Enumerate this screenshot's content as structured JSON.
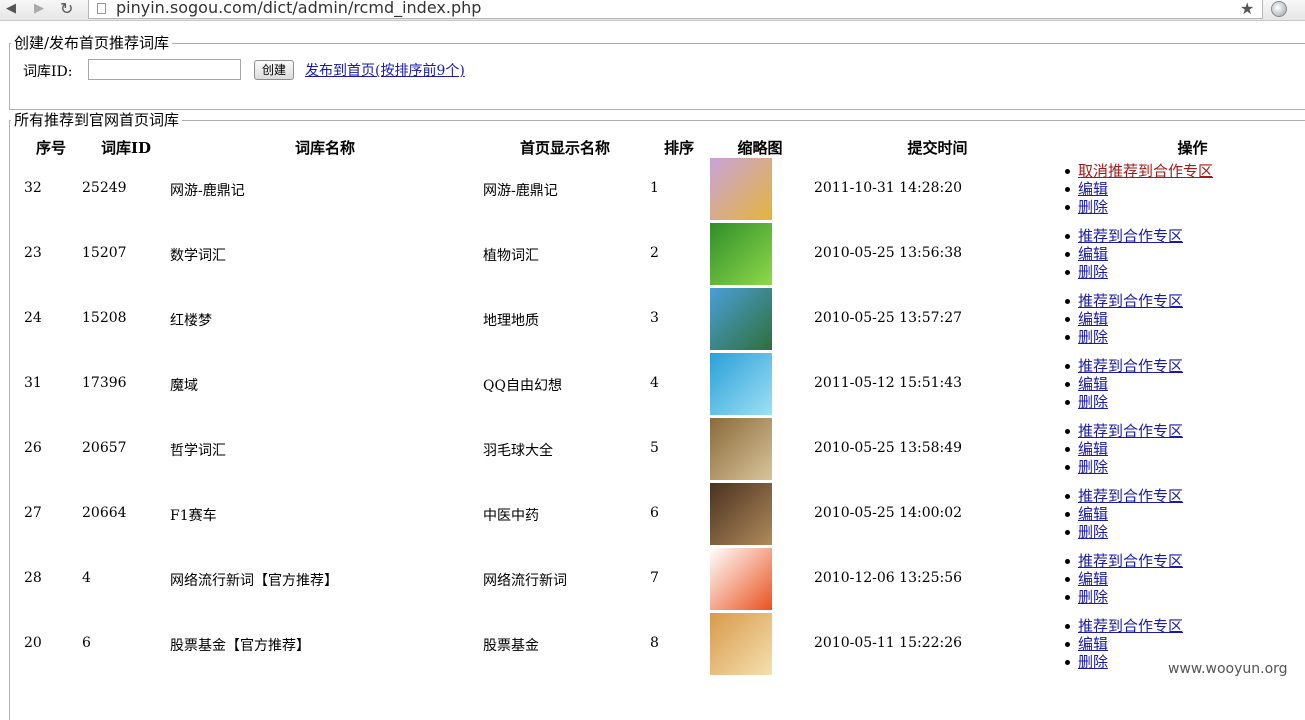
{
  "browser": {
    "url": "pinyin.sogou.com/dict/admin/rcmd_index.php",
    "icons": [
      "back-icon",
      "forward-icon",
      "reload-icon",
      "page-icon",
      "star-icon",
      "globe-icon"
    ]
  },
  "create_section": {
    "legend": "创建/发布首页推荐词库",
    "id_label": "词库ID:",
    "id_value": "",
    "create_button": "创建",
    "publish_link": "发布到首页(按排序前9个)"
  },
  "list_section": {
    "legend": "所有推荐到官网首页词库",
    "headers": [
      "序号",
      "词库ID",
      "词库名称",
      "首页显示名称",
      "排序",
      "缩略图",
      "提交时间",
      "操作"
    ],
    "rows": [
      {
        "seq": "32",
        "id": "25249",
        "name": "网游-鹿鼎记",
        "display": "网游-鹿鼎记",
        "order": "1",
        "thumb": "luding-game-thumb",
        "time": "2011-10-31 14:28:20",
        "ops": [
          "取消推荐到合作专区",
          "编辑",
          "删除"
        ],
        "thumb_colors": [
          "#c9a3d9",
          "#e4b43a"
        ]
      },
      {
        "seq": "23",
        "id": "15207",
        "name": "数学词汇",
        "display": "植物词汇",
        "order": "2",
        "thumb": "clover-thumb",
        "time": "2010-05-25 13:56:38",
        "ops": [
          "推荐到合作专区",
          "编辑",
          "删除"
        ],
        "thumb_colors": [
          "#2f8f2a",
          "#8fd84a"
        ]
      },
      {
        "seq": "24",
        "id": "15208",
        "name": "红楼梦",
        "display": "地理地质",
        "order": "3",
        "thumb": "coast-thumb",
        "time": "2010-05-25 13:57:27",
        "ops": [
          "推荐到合作专区",
          "编辑",
          "删除"
        ],
        "thumb_colors": [
          "#4a9fd8",
          "#2f6f3a"
        ]
      },
      {
        "seq": "31",
        "id": "17396",
        "name": "魔域",
        "display": "QQ自由幻想",
        "order": "4",
        "thumb": "qq-fantasy-thumb",
        "time": "2011-05-12 15:51:43",
        "ops": [
          "推荐到合作专区",
          "编辑",
          "删除"
        ],
        "thumb_colors": [
          "#2aa0d8",
          "#9fe0f5"
        ]
      },
      {
        "seq": "26",
        "id": "20657",
        "name": "哲学词汇",
        "display": "羽毛球大全",
        "order": "5",
        "thumb": "badminton-thumb",
        "time": "2010-05-25 13:58:49",
        "ops": [
          "推荐到合作专区",
          "编辑",
          "删除"
        ],
        "thumb_colors": [
          "#8a6a3a",
          "#d8c49a"
        ]
      },
      {
        "seq": "27",
        "id": "20664",
        "name": "F1赛车",
        "display": "中医中药",
        "order": "6",
        "thumb": "herbs-thumb",
        "time": "2010-05-25 14:00:02",
        "ops": [
          "推荐到合作专区",
          "编辑",
          "删除"
        ],
        "thumb_colors": [
          "#4a3220",
          "#b08a5a"
        ]
      },
      {
        "seq": "28",
        "id": "4",
        "name": "网络流行新词【官方推荐】",
        "display": "网络流行新词",
        "order": "7",
        "thumb": "sogou-logo-thumb",
        "time": "2010-12-06 13:25:56",
        "ops": [
          "推荐到合作专区",
          "编辑",
          "删除"
        ],
        "thumb_colors": [
          "#ffffff",
          "#e8521f"
        ]
      },
      {
        "seq": "20",
        "id": "6",
        "name": "股票基金【官方推荐】",
        "display": "股票基金",
        "order": "8",
        "thumb": "coin-thumb",
        "time": "2010-05-11 15:22:26",
        "ops": [
          "推荐到合作专区",
          "编辑",
          "删除"
        ],
        "thumb_colors": [
          "#d89a4a",
          "#f5e0b0"
        ]
      }
    ]
  },
  "watermark": "www.wooyun.org"
}
